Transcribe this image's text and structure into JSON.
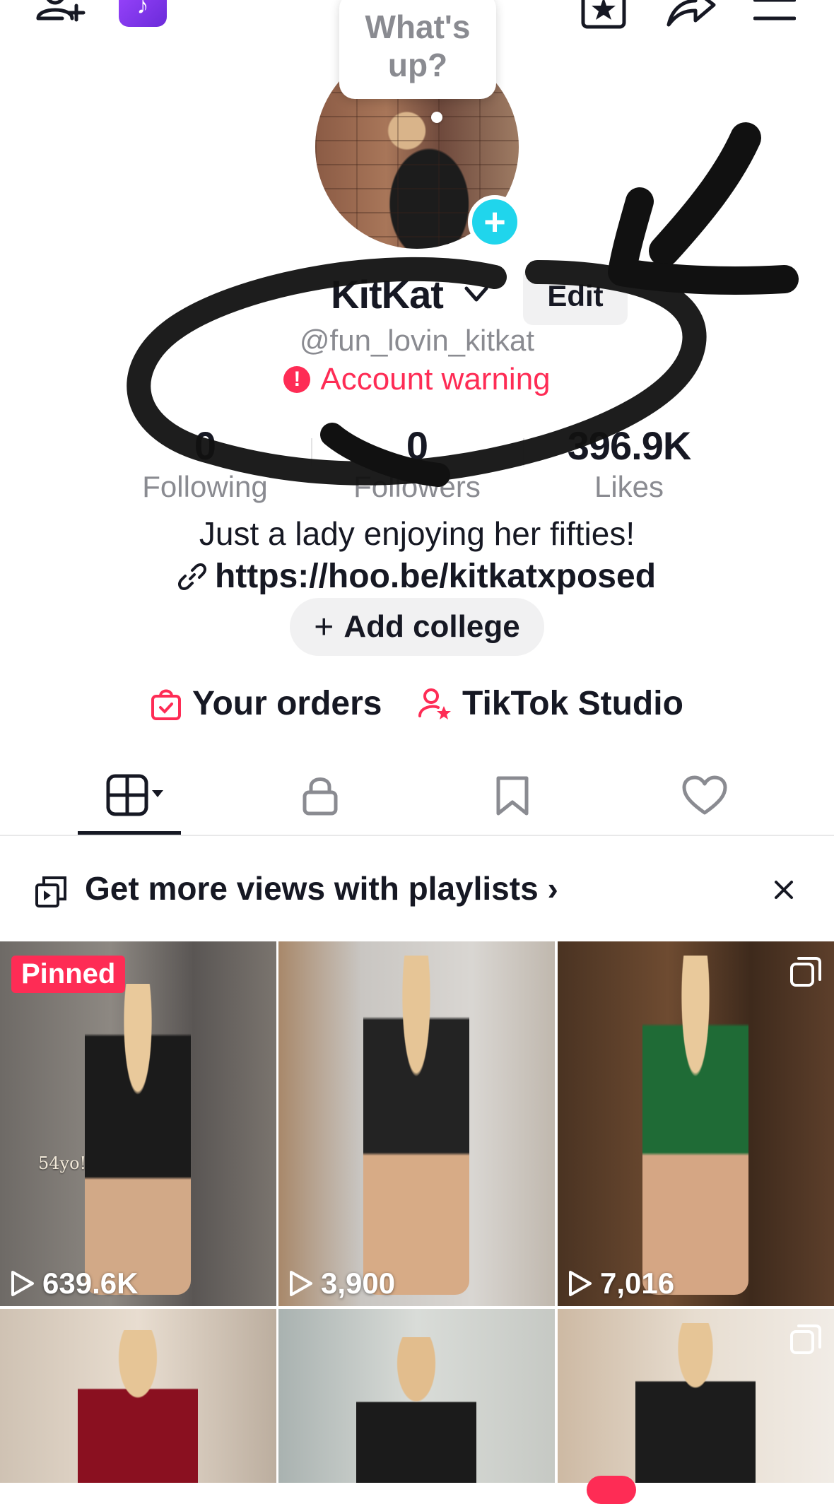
{
  "topbar": {
    "add_friend_icon": "person-plus-icon",
    "tiktok_icon": "tiktok-note-icon",
    "favorites_icon": "bookmark-star-icon",
    "share_icon": "share-arrow-icon",
    "menu_icon": "hamburger-menu-icon"
  },
  "bubble": {
    "text": "What's up?"
  },
  "profile": {
    "display_name": "KitKat",
    "edit_label": "Edit",
    "handle": "@fun_lovin_kitkat",
    "warning": "Account warning"
  },
  "stats": [
    {
      "value": "0",
      "label": "Following"
    },
    {
      "value": "0",
      "label": "Followers"
    },
    {
      "value": "396.9K",
      "label": "Likes"
    }
  ],
  "bio": "Just a lady enjoying her fifties!",
  "link": "https://hoo.be/kitkatxposed",
  "add_college": "Add college",
  "quick_links": {
    "orders": "Your orders",
    "studio": "TikTok Studio"
  },
  "tabs": [
    "videos",
    "private",
    "saved",
    "liked"
  ],
  "promo": {
    "text": "Get more views with playlists",
    "chevron": "›"
  },
  "videos": [
    {
      "views": "639.6K",
      "pinned_label": "Pinned",
      "overlay": "54yo!"
    },
    {
      "views": "3,900"
    },
    {
      "views": "7,016"
    },
    {
      "views": ""
    },
    {
      "views": ""
    },
    {
      "views": ""
    }
  ],
  "colors": {
    "accent": "#fe2c55",
    "badge": "#20d5ec",
    "text": "#161823",
    "muted": "#8a8b91"
  }
}
